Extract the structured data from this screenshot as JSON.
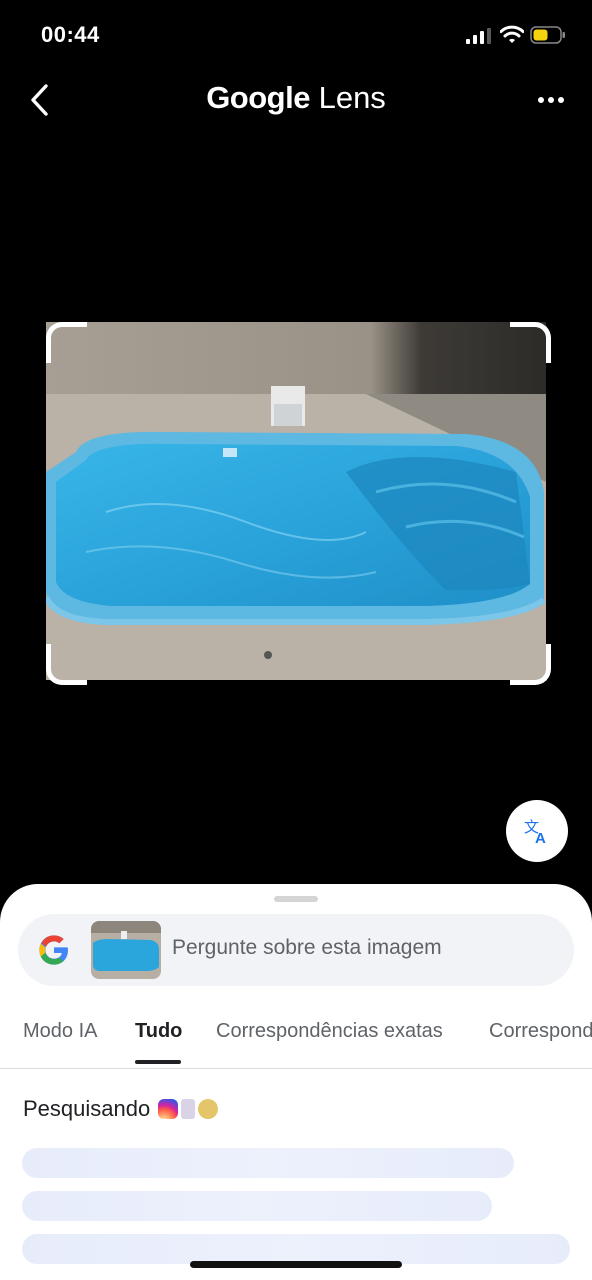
{
  "status_bar": {
    "time": "00:44"
  },
  "header": {
    "title_part1": "Google",
    "title_part2": " Lens"
  },
  "search": {
    "placeholder": "Pergunte sobre esta imagem"
  },
  "tabs": [
    {
      "label": "Modo IA"
    },
    {
      "label": "Tudo"
    },
    {
      "label": "Correspondências exatas"
    },
    {
      "label": "Correspondências"
    }
  ],
  "results": {
    "searching_label": "Pesquisando"
  },
  "colors": {
    "pool_water": "#2ea8de",
    "pool_rim": "#5cb7e3",
    "deck": "#b9b1a6",
    "wall": "#a8a095",
    "sheet_bg": "#ffffff",
    "skeleton": "#e7ecfb",
    "translate_icon": "#1a73e8"
  },
  "icons": {
    "back": "chevron-left-icon",
    "more": "more-horizontal-icon",
    "translate": "translate-icon",
    "google": "google-g-icon"
  }
}
